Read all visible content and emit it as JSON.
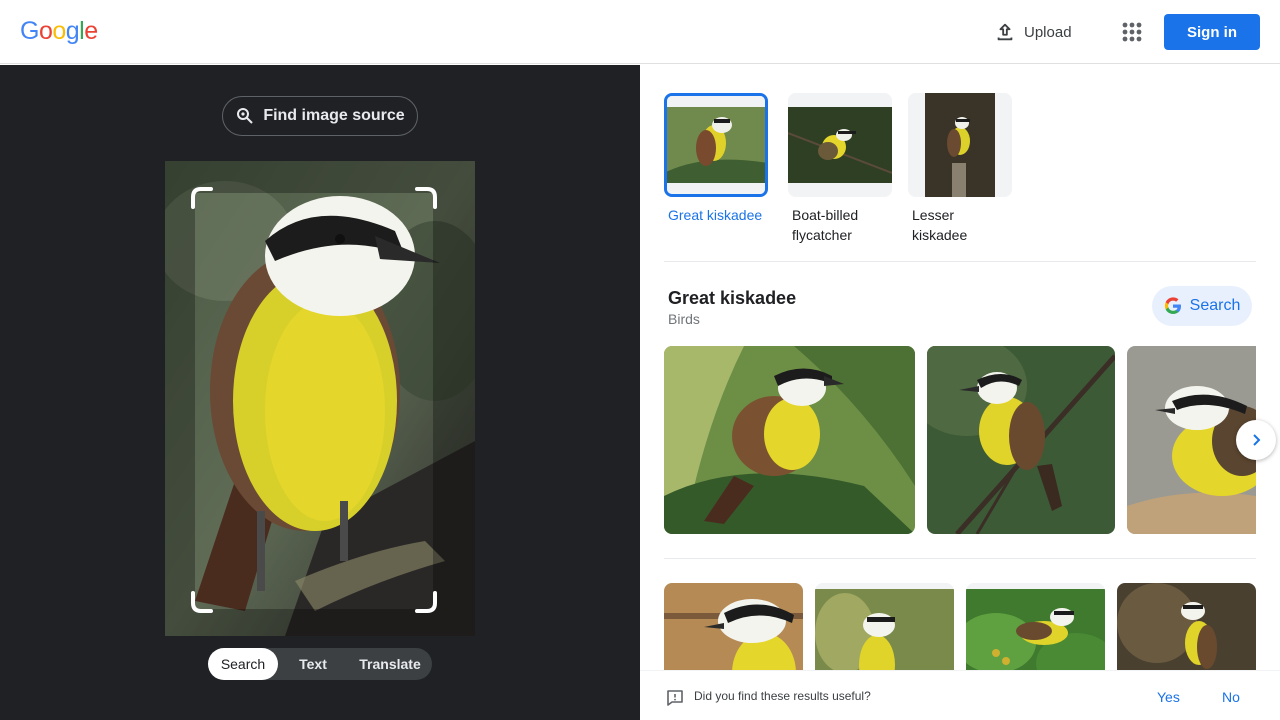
{
  "header": {
    "logo_letters": [
      "G",
      "o",
      "o",
      "g",
      "l",
      "e"
    ],
    "upload_label": "Upload",
    "signin_label": "Sign in"
  },
  "left": {
    "find_source_label": "Find image source",
    "tabs": [
      {
        "label": "Search",
        "active": true
      },
      {
        "label": "Text",
        "active": false
      },
      {
        "label": "Translate",
        "active": false
      }
    ]
  },
  "matches": [
    {
      "label": "Great kiskadee",
      "selected": true
    },
    {
      "label": "Boat-billed flycatcher",
      "selected": false
    },
    {
      "label": "Lesser kiskadee",
      "selected": false
    }
  ],
  "entity": {
    "title": "Great kiskadee",
    "subtitle": "Birds",
    "search_label": "Search"
  },
  "feedback": {
    "question": "Did you find these results useful?",
    "yes": "Yes",
    "no": "No"
  },
  "colors": {
    "accent": "#1a73e8",
    "dark_panel": "#202124",
    "bird_yellow": "#e4d62a"
  }
}
